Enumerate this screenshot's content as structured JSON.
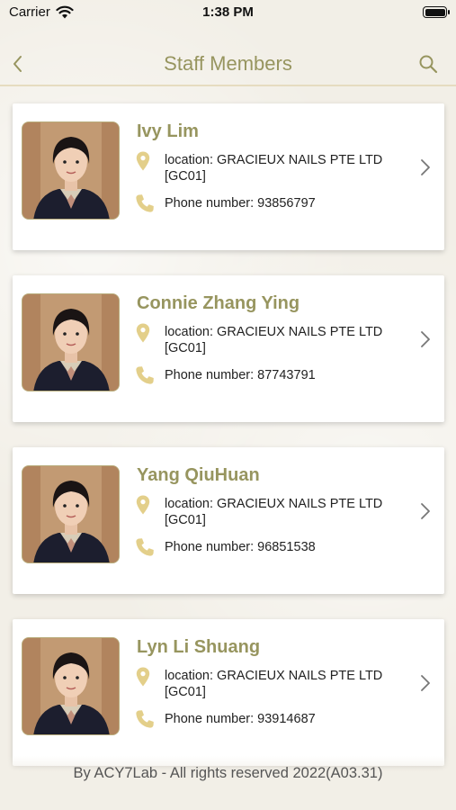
{
  "status_bar": {
    "carrier": "Carrier",
    "time": "1:38 PM"
  },
  "nav": {
    "title": "Staff Members"
  },
  "colors": {
    "accent": "#97955f",
    "icon_gold": "#e3cf8a"
  },
  "staff": [
    {
      "name": "Ivy Lim",
      "location": "location: GRACIEUX NAILS PTE LTD [GC01]",
      "phone": "Phone number: 93856797"
    },
    {
      "name": "Connie Zhang Ying",
      "location": "location: GRACIEUX NAILS PTE LTD [GC01]",
      "phone": "Phone number: 87743791"
    },
    {
      "name": "Yang QiuHuan",
      "location": "location: GRACIEUX NAILS PTE LTD [GC01]",
      "phone": "Phone number: 96851538"
    },
    {
      "name": "Lyn Li Shuang",
      "location": "location: GRACIEUX NAILS PTE LTD [GC01]",
      "phone": "Phone number: 93914687"
    }
  ],
  "footer": "By ACY7Lab - All rights reserved 2022(A03.31)"
}
